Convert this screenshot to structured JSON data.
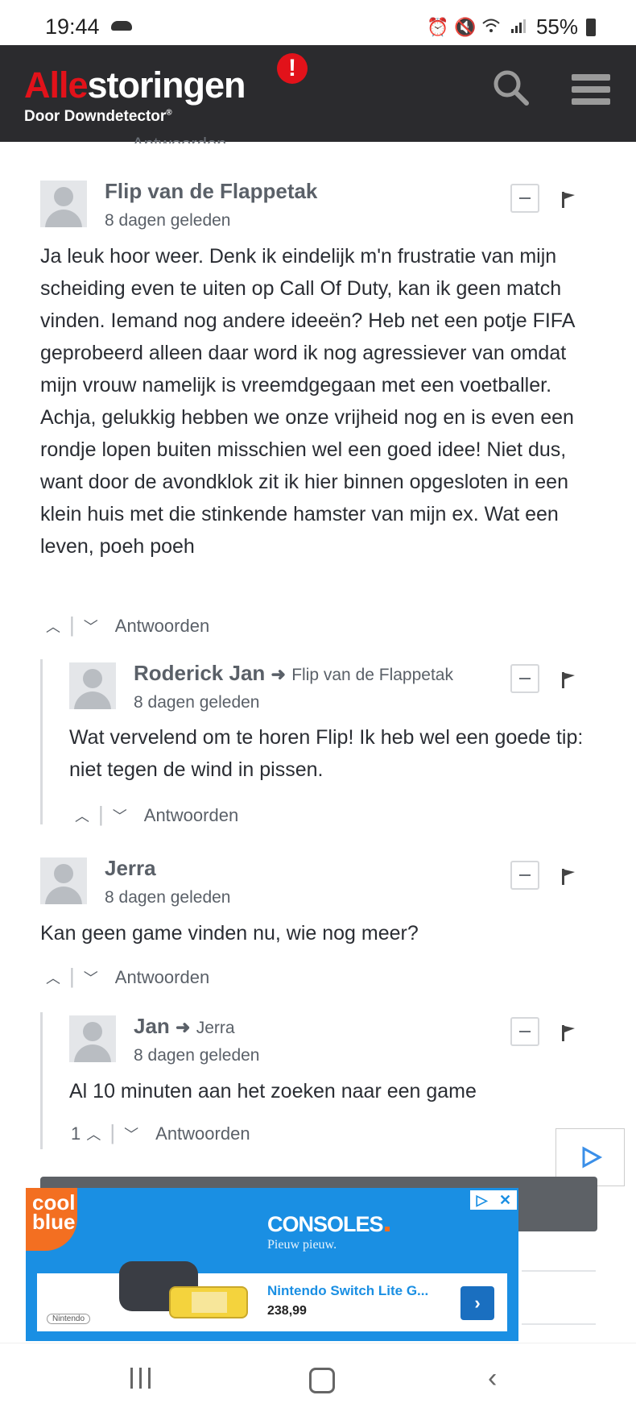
{
  "status_bar": {
    "time": "19:44",
    "battery": "55%"
  },
  "header": {
    "logo_prefix": "Alle",
    "logo_suffix": "storingen",
    "logo_mark": "!",
    "logo_sub": "Door Downdetector",
    "logo_reg": "®",
    "icons": [
      "search-icon",
      "menu-icon"
    ]
  },
  "partial_actions": "Antwoorden",
  "comments": [
    {
      "author": "Flip van de Flappetak",
      "date": "8 dagen geleden",
      "text": "Ja leuk hoor weer. Denk ik eindelijk m'n frustratie van mijn scheiding even te uiten op Call Of Duty, kan ik geen match vinden. Iemand nog andere ideeën? Heb net een potje FIFA geprobeerd alleen daar word ik nog agressiever van omdat mijn vrouw namelijk is vreemdgegaan met een voetballer. Achja, gelukkig hebben we onze vrijheid nog en is even een rondje lopen buiten misschien wel een goed idee! Niet dus, want door de avondklok zit ik hier binnen opgesloten in een klein huis met die stinkende hamster van mijn ex. Wat een leven, poeh poeh",
      "reply_label": "Antwoorden",
      "replies": [
        {
          "author": "Roderick Jan",
          "reply_to": "Flip van de Flappetak",
          "date": "8 dagen geleden",
          "text": "Wat vervelend om te horen Flip! Ik heb wel een goede tip: niet tegen de wind in pissen.",
          "reply_label": "Antwoorden"
        }
      ]
    },
    {
      "author": "Jerra",
      "date": "8 dagen geleden",
      "text": "Kan geen game vinden nu, wie nog meer?",
      "reply_label": "Antwoorden",
      "replies": [
        {
          "author": "Jan",
          "reply_to": "Jerra",
          "date": "8 dagen geleden",
          "text": "Al 10 minuten aan het zoeken naar een game",
          "upvotes": "1",
          "reply_label": "Antwoorden"
        }
      ]
    }
  ],
  "ad": {
    "brand_line1": "cool",
    "brand_line2": "blue",
    "title": "CONSOLES",
    "subtitle": "Pieuw pieuw.",
    "product": "Nintendo Switch Lite G...",
    "price": "238,99",
    "nintendo": "Nintendo",
    "accent_color": "#1a8fe3",
    "brand_color": "#f36f21"
  },
  "colors": {
    "header_bg": "#2b2b2e",
    "logo_red": "#e2121a"
  }
}
